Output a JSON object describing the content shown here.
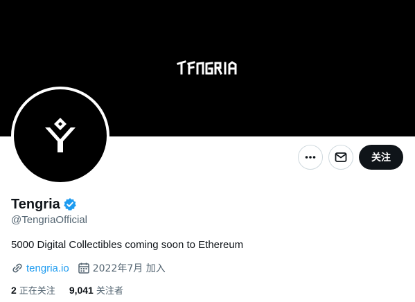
{
  "banner": {
    "logo_text": "TENGRIA"
  },
  "profile": {
    "display_name": "Tengria",
    "handle": "@TengriaOfficial",
    "bio": "5000 Digital Collectibles coming soon to Ethereum",
    "website": "tengria.io",
    "joined": "2022年7月 加入",
    "verified": true
  },
  "actions": {
    "more_icon": "more-icon",
    "message_icon": "envelope-icon",
    "follow_label": "关注"
  },
  "stats": {
    "following_count": "2",
    "following_label": "正在关注",
    "followers_count": "9,041",
    "followers_label": "关注者"
  },
  "colors": {
    "accent": "#1d9bf0",
    "text_primary": "#0f1419",
    "text_secondary": "#536471",
    "border": "#cfd9de",
    "banner": "#000000"
  }
}
